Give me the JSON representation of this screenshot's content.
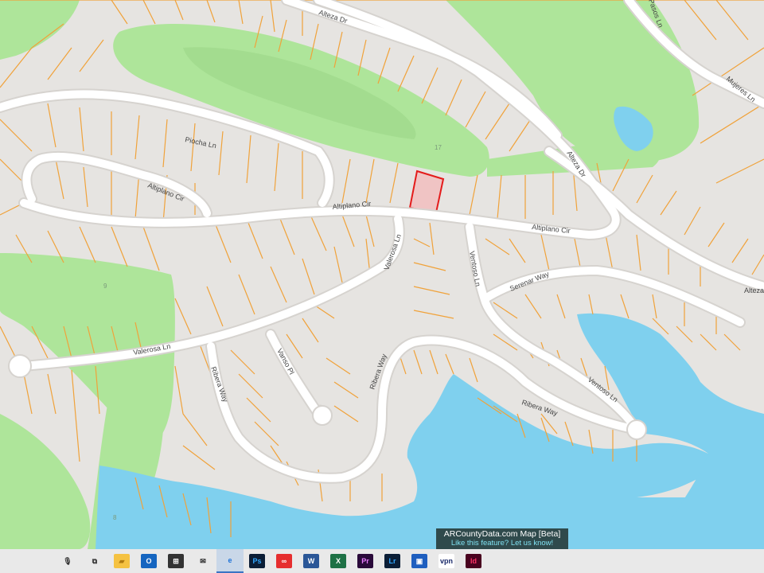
{
  "map": {
    "streets": [
      {
        "name": "alteza-dr-top",
        "label": "Alteza Dr"
      },
      {
        "name": "alteza-dr-mid",
        "label": "Alteza Dr"
      },
      {
        "name": "alteza-dr-right",
        "label": "Alteza"
      },
      {
        "name": "mujeres-ln",
        "label": "Mujeres Ln"
      },
      {
        "name": "pasos-ln",
        "label": "Pasos Ln"
      },
      {
        "name": "piocha-ln",
        "label": "Piocha Ln"
      },
      {
        "name": "altiplano-cir-loop",
        "label": "Altiplano Cir"
      },
      {
        "name": "altiplano-cir-main",
        "label": "Altiplano Cir"
      },
      {
        "name": "altiplano-cir-east",
        "label": "Altiplano Cir"
      },
      {
        "name": "valerosa-ln-north",
        "label": "Valerosa Ln"
      },
      {
        "name": "valerosa-ln-west",
        "label": "Valerosa Ln"
      },
      {
        "name": "ventoso-ln-north",
        "label": "Ventoso Ln"
      },
      {
        "name": "ventoso-ln-south",
        "label": "Ventoso Ln"
      },
      {
        "name": "serenar-way",
        "label": "Serenar Way"
      },
      {
        "name": "ribera-way-west",
        "label": "Ribera Way"
      },
      {
        "name": "ribera-way-mid",
        "label": "Ribera Way"
      },
      {
        "name": "ribera-way-east",
        "label": "Ribera Way"
      },
      {
        "name": "vanso-pl",
        "label": "Vanso Pl"
      }
    ],
    "hole_numbers": [
      "17",
      "9",
      "8"
    ],
    "colors": {
      "land": "#e6e4e1",
      "parcel_line": "#f0a23a",
      "road": "#ffffff",
      "road_edge": "#d6d3cf",
      "golf": "#aee59a",
      "golf_inner": "#9ed88a",
      "water": "#7fd0ee",
      "selected_parcel_fill": "#f0c4c4",
      "selected_parcel_stroke": "#e41b1b"
    }
  },
  "banner": {
    "title": "ARCountyData.com Map [Beta]",
    "subtitle": "Like this feature? Let us know!"
  },
  "taskbar": {
    "icons": [
      {
        "name": "microphone-icon",
        "glyph": "🎙",
        "bg": "transparent",
        "fg": "#333"
      },
      {
        "name": "task-view-icon",
        "glyph": "⧉",
        "bg": "transparent",
        "fg": "#333"
      },
      {
        "name": "file-explorer-icon",
        "glyph": "▰",
        "bg": "#f5c242",
        "fg": "#b07a10"
      },
      {
        "name": "outlook-icon",
        "glyph": "O",
        "bg": "#1565c0",
        "fg": "#ffffff"
      },
      {
        "name": "store-icon",
        "glyph": "⊞",
        "bg": "#333",
        "fg": "#ffffff"
      },
      {
        "name": "mail-icon",
        "glyph": "✉",
        "bg": "transparent",
        "fg": "#222"
      },
      {
        "name": "edge-icon",
        "glyph": "e",
        "bg": "transparent",
        "fg": "#1e73d8"
      },
      {
        "name": "photoshop-icon",
        "glyph": "Ps",
        "bg": "#0b1e36",
        "fg": "#31a8ff"
      },
      {
        "name": "creative-cloud-icon",
        "glyph": "∞",
        "bg": "#e62e2e",
        "fg": "#ffffff"
      },
      {
        "name": "word-icon",
        "glyph": "W",
        "bg": "#2b5797",
        "fg": "#ffffff"
      },
      {
        "name": "excel-icon",
        "glyph": "X",
        "bg": "#1e7145",
        "fg": "#ffffff"
      },
      {
        "name": "premiere-icon",
        "glyph": "Pr",
        "bg": "#2a0a3a",
        "fg": "#e77cff"
      },
      {
        "name": "lightroom-icon",
        "glyph": "Lr",
        "bg": "#0b1e36",
        "fg": "#31a8ff"
      },
      {
        "name": "reader-icon",
        "glyph": "▣",
        "bg": "#1f5fbf",
        "fg": "#ffffff"
      },
      {
        "name": "vpn-icon",
        "glyph": "vpn",
        "bg": "#ffffff",
        "fg": "#1a2a6a"
      },
      {
        "name": "indesign-icon",
        "glyph": "Id",
        "bg": "#49021f",
        "fg": "#ff3366"
      }
    ],
    "active_icon": "edge-icon"
  }
}
